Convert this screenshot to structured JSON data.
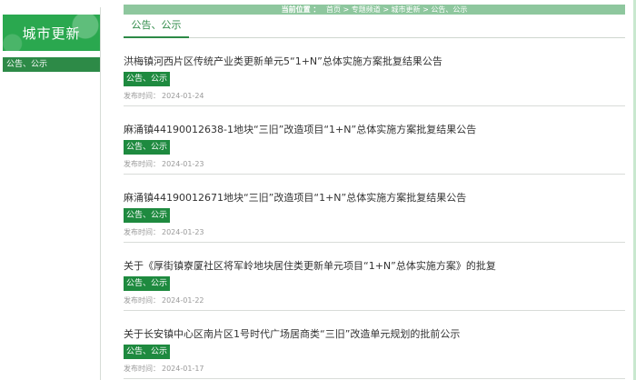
{
  "sidebar": {
    "title": "城市更新",
    "items": [
      {
        "label": "公告、公示"
      }
    ]
  },
  "breadcrumb": {
    "label": "当前位置 ：",
    "path": "首页 > 专题频道 > 城市更新 > 公告、公示"
  },
  "tabs": [
    {
      "label": "公告、公示",
      "active": true
    }
  ],
  "list": {
    "date_prefix": "发布时间：",
    "items": [
      {
        "title": "洪梅镇河西片区传统产业类更新单元5“1+N”总体实施方案批复结果公告",
        "tag": "公告、公示",
        "date": "2024-01-24"
      },
      {
        "title": "麻涌镇44190012638-1地块“三旧”改造项目“1+N”总体实施方案批复结果公告",
        "tag": "公告、公示",
        "date": "2024-01-23"
      },
      {
        "title": "麻涌镇44190012671地块“三旧”改造项目“1+N”总体实施方案批复结果公告",
        "tag": "公告、公示",
        "date": "2024-01-23"
      },
      {
        "title": "关于《厚街镇寮厦社区将军岭地块居住类更新单元项目“1+N”总体实施方案》的批复",
        "tag": "公告、公示",
        "date": "2024-01-22"
      },
      {
        "title": "关于长安镇中心区南片区1号时代广场居商类“三旧”改造单元规划的批前公示",
        "tag": "公告、公示",
        "date": "2024-01-17"
      }
    ]
  },
  "colors": {
    "brand": "#2aa84f",
    "accent": "#1e8a3f",
    "breadcrumb_bg": "#8ec79e"
  }
}
